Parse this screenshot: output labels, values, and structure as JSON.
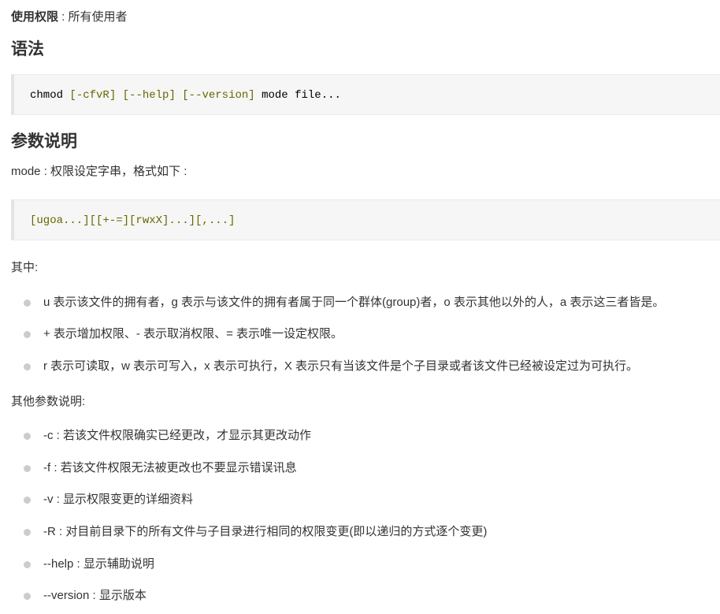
{
  "permission": {
    "label": "使用权限",
    "separator": " : ",
    "value": "所有使用者"
  },
  "syntax": {
    "heading": "语法",
    "code": {
      "cmd": "chmod ",
      "opt1": "[-cfvR]",
      "sp1": " ",
      "opt2": "[--help]",
      "sp2": " ",
      "opt3": "[--version]",
      "rest": " mode file..."
    }
  },
  "params": {
    "heading": "参数说明",
    "mode_desc": "mode : 权限设定字串，格式如下 :",
    "mode_code": "[ugoa...][[+-=][rwxX]...][,...]",
    "where_label": "其中:",
    "where_items": [
      "u 表示该文件的拥有者，g 表示与该文件的拥有者属于同一个群体(group)者，o 表示其他以外的人，a 表示这三者皆是。",
      "+ 表示增加权限、- 表示取消权限、= 表示唯一设定权限。",
      "r 表示可读取，w 表示可写入，x 表示可执行，X 表示只有当该文件是个子目录或者该文件已经被设定过为可执行。"
    ],
    "other_label": "其他参数说明:",
    "other_items": [
      "-c : 若该文件权限确实已经更改，才显示其更改动作",
      "-f : 若该文件权限无法被更改也不要显示错误讯息",
      "-v : 显示权限变更的详细资料",
      "-R : 对目前目录下的所有文件与子目录进行相同的权限变更(即以递归的方式逐个变更)",
      "--help : 显示辅助说明",
      "--version : 显示版本"
    ]
  },
  "colors": {
    "code_bracket": "#666600",
    "code_background": "#f6f6f6",
    "bullet": "#cccccc"
  }
}
